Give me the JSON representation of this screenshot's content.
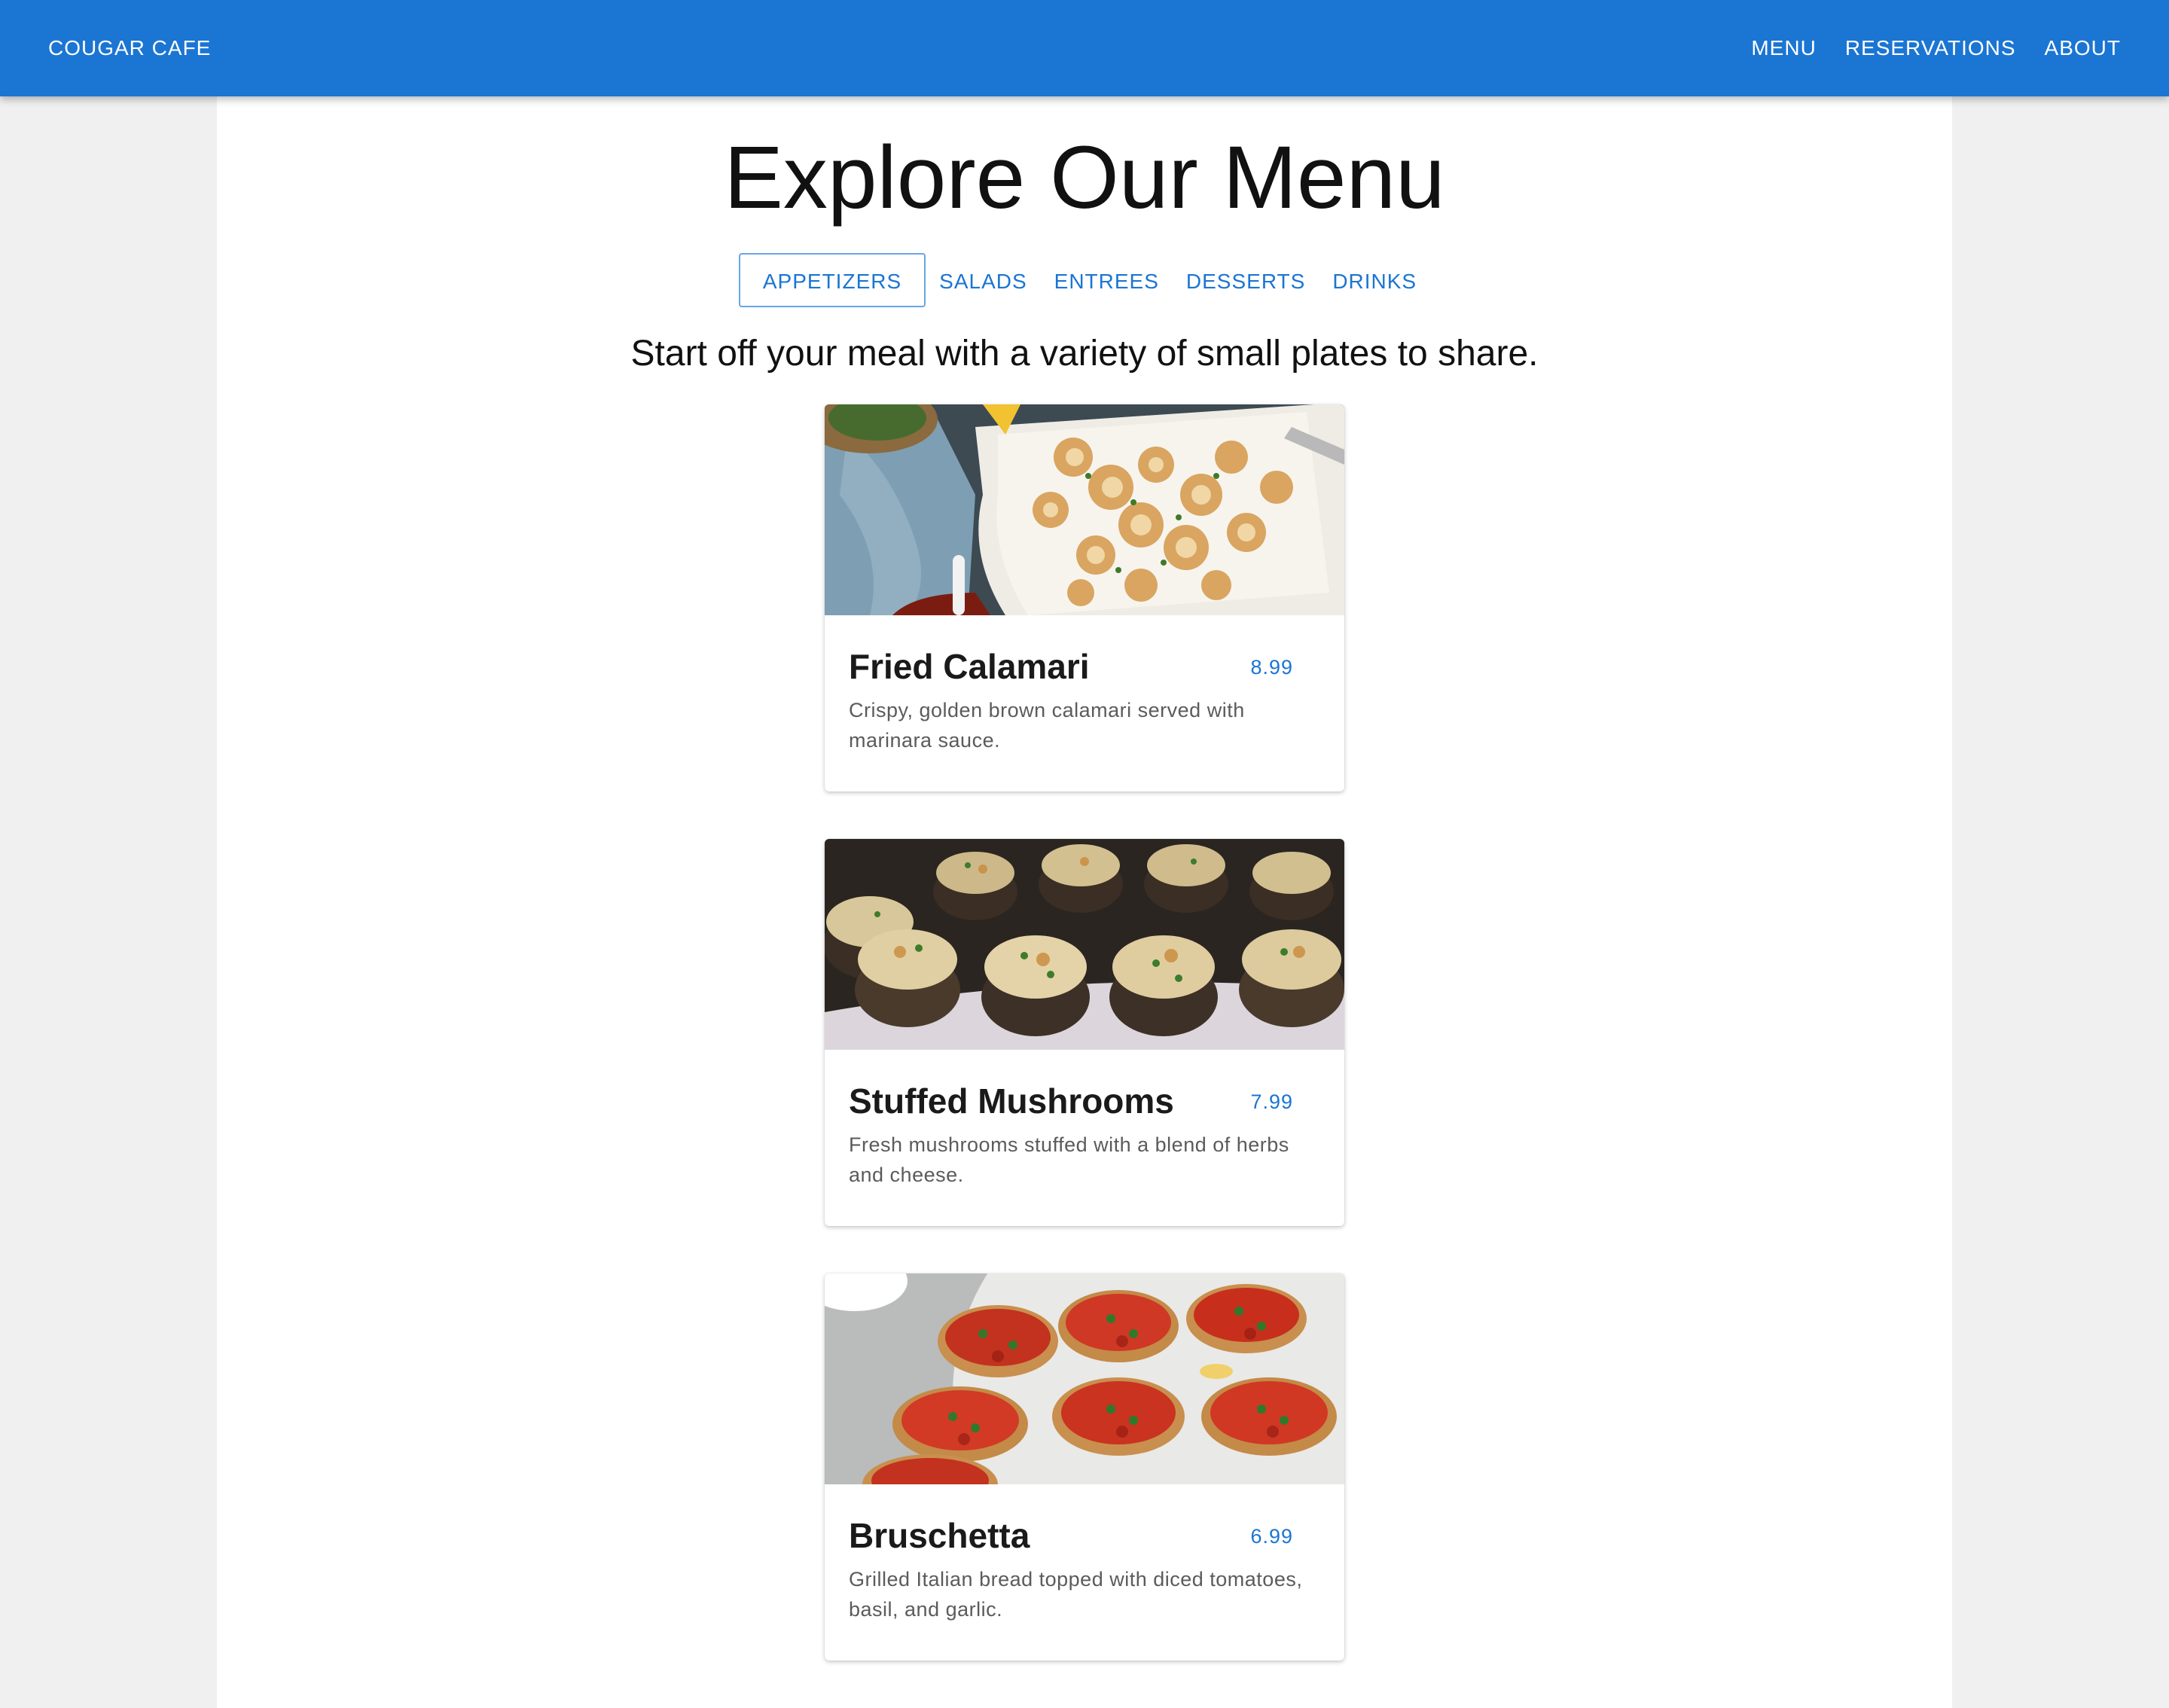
{
  "header": {
    "brand": "COUGAR CAFE",
    "nav": [
      "MENU",
      "RESERVATIONS",
      "ABOUT"
    ],
    "color": "#1b75d3"
  },
  "main": {
    "title": "Explore Our Menu",
    "tabs": [
      "APPETIZERS",
      "SALADS",
      "ENTREES",
      "DESSERTS",
      "DRINKS"
    ],
    "active_tab": "APPETIZERS",
    "subtitle": "Start off your meal with a variety of small plates to share."
  },
  "items": [
    {
      "name": "Fried Calamari",
      "price": "8.99",
      "description": "Crispy, golden brown calamari served with marinara sauce.",
      "image_icon": "fried-calamari-photo"
    },
    {
      "name": "Stuffed Mushrooms",
      "price": "7.99",
      "description": "Fresh mushrooms stuffed with a blend of herbs and cheese.",
      "image_icon": "stuffed-mushrooms-photo"
    },
    {
      "name": "Bruschetta",
      "price": "6.99",
      "description": "Grilled Italian bread topped with diced tomatoes, basil, and garlic.",
      "image_icon": "bruschetta-photo"
    }
  ]
}
